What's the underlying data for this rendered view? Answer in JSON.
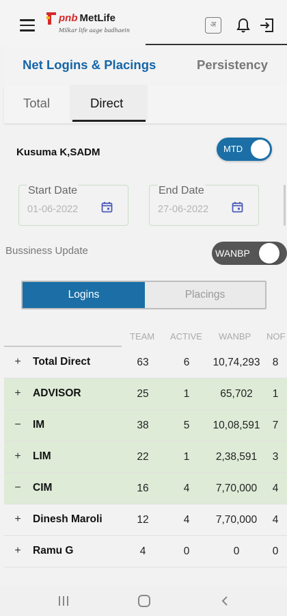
{
  "header": {
    "logo_prefix": "pnb",
    "logo_name": "MetLife",
    "logo_tagline": "Milkar life aage badhaein",
    "lang_icon_text": "अ"
  },
  "main_tabs": [
    {
      "label": "Net Logins & Placings",
      "active": true
    },
    {
      "label": "Persistency",
      "active": false
    }
  ],
  "sub_tabs": [
    {
      "label": "Total",
      "active": false
    },
    {
      "label": "Direct",
      "active": true
    }
  ],
  "user": {
    "name": "Kusuma K,SADM"
  },
  "period_toggle": {
    "label": "MTD",
    "on": true
  },
  "start_date": {
    "label": "Start Date",
    "value": "01-06-2022"
  },
  "end_date": {
    "label": "End Date",
    "value": "27-06-2022"
  },
  "business_update": {
    "label": "Bussiness Update",
    "toggle_label": "WANBP"
  },
  "segment": {
    "logins": "Logins",
    "placings": "Placings",
    "selected": "Logins"
  },
  "table": {
    "columns": [
      "TEAM",
      "ACTIVE",
      "WANBP",
      "NOF"
    ],
    "rows": [
      {
        "sign": "+",
        "name": "Total Direct",
        "team": "63",
        "active": "6",
        "wanbp": "10,74,293",
        "nop": "8",
        "highlight": false
      },
      {
        "sign": "+",
        "name": "ADVISOR",
        "team": "25",
        "active": "1",
        "wanbp": "65,702",
        "nop": "1",
        "highlight": true
      },
      {
        "sign": "−",
        "name": "IM",
        "team": "38",
        "active": "5",
        "wanbp": "10,08,591",
        "nop": "7",
        "highlight": true
      },
      {
        "sign": "+",
        "name": "LIM",
        "team": "22",
        "active": "1",
        "wanbp": "2,38,591",
        "nop": "3",
        "highlight": true
      },
      {
        "sign": "−",
        "name": "CIM",
        "team": "16",
        "active": "4",
        "wanbp": "7,70,000",
        "nop": "4",
        "highlight": true
      },
      {
        "sign": "+",
        "name": "Dinesh Maroli",
        "team": "12",
        "active": "4",
        "wanbp": "7,70,000",
        "nop": "4",
        "highlight": false
      },
      {
        "sign": "+",
        "name": "Ramu G",
        "team": "4",
        "active": "0",
        "wanbp": "0",
        "nop": "0",
        "highlight": false
      }
    ]
  },
  "colors": {
    "primary": "#1b6fa6",
    "tab_active": "#1565a8",
    "row_highlight": "#deebd7",
    "brand_red": "#d42a2a"
  },
  "icons": [
    "menu-icon",
    "pnb-metlife-logo",
    "language-icon",
    "bell-icon",
    "logout-icon",
    "calendar-icon",
    "expand-icon",
    "collapse-icon",
    "recents-icon",
    "home-icon",
    "back-icon"
  ]
}
